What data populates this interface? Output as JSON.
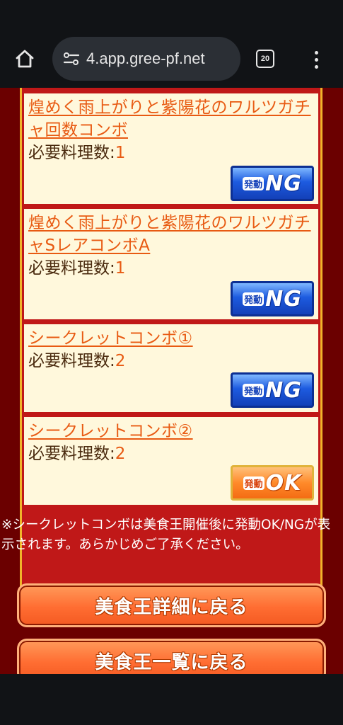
{
  "browser": {
    "url": "4.app.gree-pf.net",
    "tab_count": "20"
  },
  "combos": [
    {
      "title": "煌めく雨上がりと紫陽花のワルツガチャ回数コンボ",
      "required_label": "必要料理数:",
      "required_value": "1",
      "badge_small": "発動",
      "badge_big": "NG"
    },
    {
      "title": "煌めく雨上がりと紫陽花のワルツガチャSレアコンボA",
      "required_label": "必要料理数:",
      "required_value": "1",
      "badge_small": "発動",
      "badge_big": "NG"
    },
    {
      "title": "シークレットコンボ①",
      "required_label": "必要料理数:",
      "required_value": "2",
      "badge_small": "発動",
      "badge_big": "NG"
    },
    {
      "title": "シークレットコンボ②",
      "required_label": "必要料理数:",
      "required_value": "2",
      "badge_small": "発動",
      "badge_big": "OK"
    }
  ],
  "note": "※シークレットコンボは美食王開催後に発動OK/NGが表示されます。あらかじめご了承ください。",
  "buttons": {
    "detail": "美食王詳細に戻る",
    "list": "美食王一覧に戻る"
  },
  "colors": {
    "link": "#e85a12",
    "page_background": "#6b0000",
    "panel": "#c01818",
    "card": "#fff8dc"
  }
}
